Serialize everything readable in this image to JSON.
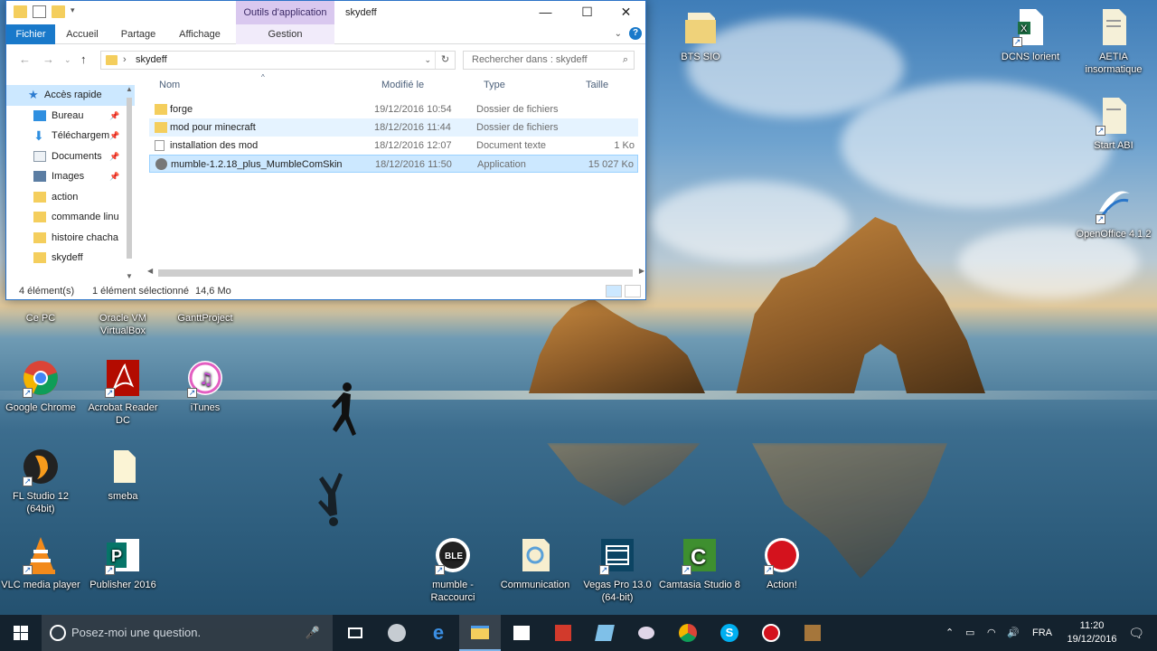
{
  "explorer": {
    "quick_access_toolbar": [
      "folder-icon",
      "properties-icon",
      "new-folder-icon"
    ],
    "tool_tab": "Outils d'application",
    "window_title": "skydeff",
    "window_controls": {
      "minimize": "—",
      "maximize": "☐",
      "close": "✕"
    },
    "ribbon_tabs": [
      "Fichier",
      "Accueil",
      "Partage",
      "Affichage",
      "Gestion"
    ],
    "address_path": "skydeff",
    "search_placeholder": "Rechercher dans : skydeff",
    "nav_pane": [
      {
        "label": "Accès rapide",
        "icon": "star-icon",
        "pinned": false
      },
      {
        "label": "Bureau",
        "icon": "desktop-icon",
        "pinned": true
      },
      {
        "label": "Téléchargem",
        "icon": "download-icon",
        "pinned": true
      },
      {
        "label": "Documents",
        "icon": "documents-icon",
        "pinned": true
      },
      {
        "label": "Images",
        "icon": "images-icon",
        "pinned": true
      },
      {
        "label": "action",
        "icon": "folder-icon",
        "pinned": false
      },
      {
        "label": "commande linu",
        "icon": "folder-icon",
        "pinned": false
      },
      {
        "label": "histoire chacha",
        "icon": "folder-icon",
        "pinned": false
      },
      {
        "label": "skydeff",
        "icon": "folder-icon",
        "pinned": false
      }
    ],
    "columns": {
      "name": "Nom",
      "modified": "Modifié le",
      "type": "Type",
      "size": "Taille"
    },
    "files": [
      {
        "name": "forge",
        "modified": "19/12/2016 10:54",
        "type": "Dossier de fichiers",
        "size": "",
        "icon": "folder-icon"
      },
      {
        "name": "mod pour minecraft",
        "modified": "18/12/2016 11:44",
        "type": "Dossier de fichiers",
        "size": "",
        "icon": "folder-icon"
      },
      {
        "name": "installation des mod",
        "modified": "18/12/2016 12:07",
        "type": "Document texte",
        "size": "1 Ko",
        "icon": "text-file-icon"
      },
      {
        "name": "mumble-1.2.18_plus_MumbleComSkin",
        "modified": "18/12/2016 11:50",
        "type": "Application",
        "size": "15 027 Ko",
        "icon": "application-icon"
      }
    ],
    "status": {
      "count": "4 élément(s)",
      "selection": "1 élément sélectionné",
      "size": "14,6 Mo"
    }
  },
  "desktop_icons": [
    {
      "label": "BTS SIO",
      "icon": "folder-doc-icon"
    },
    {
      "label": "DCNS lorient",
      "icon": "excel-file-icon"
    },
    {
      "label": "AETIA insormatique",
      "icon": "doc-file-icon"
    },
    {
      "label": "Start ABI",
      "icon": "doc-file-icon"
    },
    {
      "label": "OpenOffice 4.1.2",
      "icon": "openoffice-icon"
    },
    {
      "label": "Ce PC",
      "icon": "computer-icon"
    },
    {
      "label": "Oracle VM VirtualBox",
      "icon": "virtualbox-icon"
    },
    {
      "label": "GanttProject",
      "icon": "ganttproject-icon"
    },
    {
      "label": "Google Chrome",
      "icon": "chrome-icon"
    },
    {
      "label": "Acrobat Reader DC",
      "icon": "acrobat-icon"
    },
    {
      "label": "iTunes",
      "icon": "itunes-icon"
    },
    {
      "label": "FL Studio 12 (64bit)",
      "icon": "flstudio-icon"
    },
    {
      "label": "smeba",
      "icon": "file-icon"
    },
    {
      "label": "VLC media player",
      "icon": "vlc-icon"
    },
    {
      "label": "Publisher 2016",
      "icon": "publisher-icon"
    },
    {
      "label": "mumble - Raccourci",
      "icon": "mumble-icon"
    },
    {
      "label": "Communication",
      "icon": "folder-doc-icon"
    },
    {
      "label": "Vegas Pro 13.0 (64-bit)",
      "icon": "vegas-icon"
    },
    {
      "label": "Camtasia Studio 8",
      "icon": "camtasia-icon"
    },
    {
      "label": "Action!",
      "icon": "record-icon"
    }
  ],
  "taskbar": {
    "search_placeholder": "Posez-moi une question.",
    "pinned": [
      "task-view-icon",
      "steam-icon",
      "edge-icon",
      "file-explorer-icon",
      "store-icon",
      "gift-icon",
      "app-icon",
      "paint-icon",
      "chrome-icon",
      "skype-icon",
      "record-icon",
      "archive-icon"
    ],
    "language": "FRA",
    "time": "11:20",
    "date": "19/12/2016"
  },
  "colors": {
    "accent": "#1979ca",
    "selection": "#cce8ff",
    "tool_tab": "#d9c8ef"
  }
}
